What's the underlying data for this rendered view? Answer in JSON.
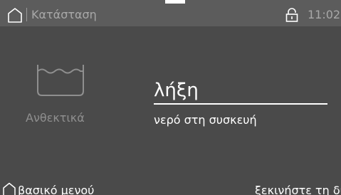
{
  "status_bar": {
    "title": "Κατάσταση",
    "time": "11:02",
    "icons": [
      "home-icon",
      "lock-icon"
    ]
  },
  "program": {
    "icon": "washtub-icon",
    "label": "Ανθεκτικά"
  },
  "main": {
    "value": "λήξη",
    "message": "νερό στη συσκευή"
  },
  "footer": {
    "home_label": "βασικό μενού",
    "start_label": "ξεκινήστε τη διαδικασία"
  },
  "colors": {
    "background": "#4a4a4a",
    "status_bar": "#5c5c5c",
    "text_primary": "#ffffff",
    "text_dim": "#a8a8a8"
  }
}
